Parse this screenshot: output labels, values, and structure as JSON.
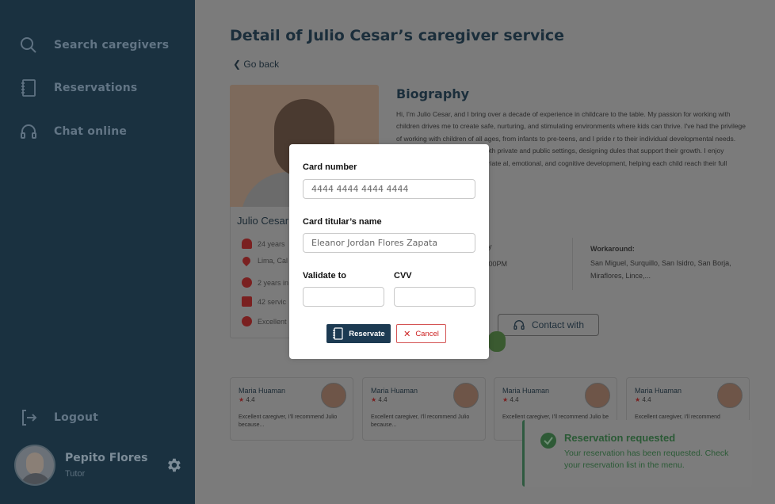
{
  "sidebar": {
    "items": [
      {
        "label": "Search caregivers",
        "icon": "search-icon"
      },
      {
        "label": "Reservations",
        "icon": "notebook-icon"
      },
      {
        "label": "Chat online",
        "icon": "headset-icon"
      }
    ],
    "logout_label": "Logout",
    "user": {
      "name": "Pepito Flores",
      "role": "Tutor"
    }
  },
  "main": {
    "title": "Detail of Julio Cesar’s caregiver service",
    "go_back": "Go back",
    "caregiver": {
      "name": "Julio Cesar",
      "details": [
        "24 years",
        "Lima, Cal",
        "2 years in",
        "42 servic",
        "Excellent"
      ]
    },
    "biography": {
      "title": "Biography",
      "text": "Hi, I'm Julio Cesar, and I bring over a decade of experience in childcare to the table. My passion for working with children drives me to create safe, nurturing, and stimulating environments where kids can thrive. I've had the privilege of working with children of all ages, from infants to pre-teens, and I pride r to their individual developmental needs. diverse groups of children in both private and public settings, designing dules that support their growth. I enjoy creating engaging, age-appropriate al, emotional, and cognitive development, helping each child reach their full"
    },
    "schedule": {
      "days_fragment": "iday",
      "time_fragment": "05:00PM"
    },
    "workaround": {
      "title": "Workaround:",
      "text": "San Miguel, Surquillo, San Isidro, San Borja, Miraflores, Lince,..."
    },
    "contact_label": "Contact with",
    "reviews": [
      {
        "name": "Maria Huaman",
        "rating": "4.4",
        "text": "Excellent caregiver, I'll recommend Julio because..."
      },
      {
        "name": "Maria Huaman",
        "rating": "4.4",
        "text": "Excellent caregiver, I'll recommend Julio because..."
      },
      {
        "name": "Maria Huaman",
        "rating": "4.4",
        "text": "Excellent caregiver, I'll recommend Julio be"
      },
      {
        "name": "Maria Huaman",
        "rating": "4.4",
        "text": "Excellent caregiver, I'll recommend"
      }
    ]
  },
  "modal": {
    "card_number_label": "Card number",
    "card_number_placeholder": "4444 4444 4444 4444",
    "titular_label": "Card titular’s name",
    "titular_placeholder": "Eleanor Jordan Flores Zapata",
    "validate_label": "Validate to",
    "cvv_label": "CVV",
    "reservate_label": "Reservate",
    "cancel_label": "Cancel"
  },
  "toast": {
    "title": "Reservation requested",
    "message": "Your reservation has been requested. Check your reservation list in the menu."
  },
  "colors": {
    "sidebar": "#1a3140",
    "primary": "#1c3a52",
    "cancel": "#d45454",
    "success": "#2e5a36"
  }
}
